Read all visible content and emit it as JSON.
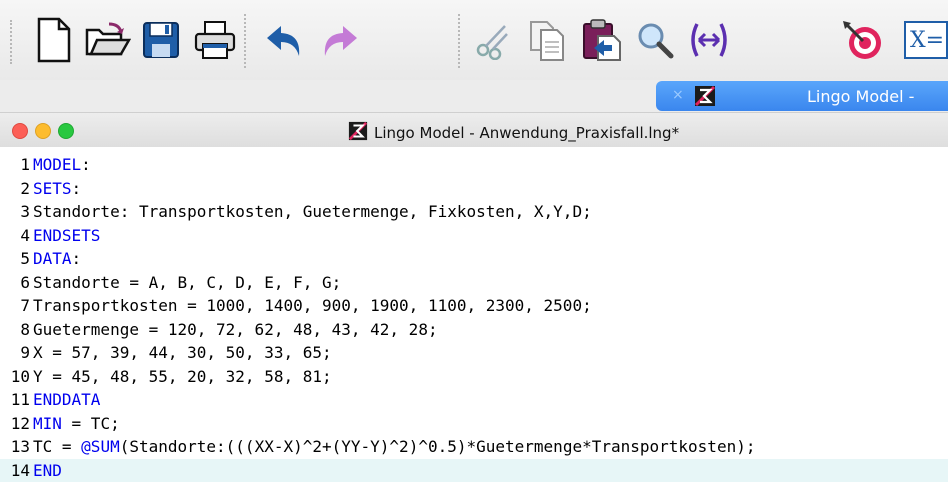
{
  "toolbar": {
    "buttons": [
      {
        "name": "new-file-icon",
        "label": "New"
      },
      {
        "name": "open-folder-icon",
        "label": "Open"
      },
      {
        "name": "save-disk-icon",
        "label": "Save"
      },
      {
        "name": "print-icon",
        "label": "Print"
      },
      {
        "name": "undo-icon",
        "label": "Undo"
      },
      {
        "name": "redo-icon",
        "label": "Redo"
      },
      {
        "name": "cut-scissors-icon",
        "label": "Cut"
      },
      {
        "name": "copy-icon",
        "label": "Copy"
      },
      {
        "name": "paste-icon",
        "label": "Paste"
      },
      {
        "name": "find-magnifier-icon",
        "label": "Find"
      },
      {
        "name": "match-parenthesis-icon",
        "label": "Match Parenthesis"
      },
      {
        "name": "solve-target-icon",
        "label": "Solve"
      },
      {
        "name": "solution-xeq-icon",
        "label": "Solution"
      }
    ],
    "solution_glyph": "X="
  },
  "tab": {
    "close_glyph": "×",
    "title": "Lingo Model -"
  },
  "window": {
    "title": "Lingo Model - Anwendung_Praxisfall.lng*"
  },
  "colors": {
    "keyword": "#0000ee",
    "current_line": "#e7f6f7",
    "tab_active": "#3a86ee",
    "close": "#fc5f57",
    "minimize": "#fdbc2e",
    "zoom": "#28c840"
  },
  "editor": {
    "current_line": 14,
    "lines": [
      {
        "n": "1",
        "kw": "MODEL",
        "rest": ":"
      },
      {
        "n": "2",
        "kw": "SETS",
        "rest": ":"
      },
      {
        "n": "3",
        "kw": "",
        "rest": "Standorte: Transportkosten, Guetermenge, Fixkosten, X,Y,D;"
      },
      {
        "n": "4",
        "kw": "ENDSETS",
        "rest": ""
      },
      {
        "n": "5",
        "kw": "DATA",
        "rest": ":"
      },
      {
        "n": "6",
        "kw": "",
        "rest": "Standorte = A, B, C, D, E, F, G;"
      },
      {
        "n": "7",
        "kw": "",
        "rest": "Transportkosten = 1000, 1400, 900, 1900, 1100, 2300, 2500;"
      },
      {
        "n": "8",
        "kw": "",
        "rest": "Guetermenge = 120, 72, 62, 48, 43, 42, 28;"
      },
      {
        "n": "9",
        "kw": "",
        "rest": "X = 57, 39, 44, 30, 50, 33, 65;"
      },
      {
        "n": "10",
        "kw": "",
        "rest": "Y = 45, 48, 55, 20, 32, 58, 81;"
      },
      {
        "n": "11",
        "kw": "ENDDATA",
        "rest": ""
      },
      {
        "n": "12",
        "kw": "MIN",
        "rest": " = TC;"
      },
      {
        "n": "13",
        "pre": "TC = ",
        "kw": "@SUM",
        "rest": "(Standorte:(((XX-X)^2+(YY-Y)^2)^0.5)*Guetermenge*Transportkosten);"
      },
      {
        "n": "14",
        "kw": "END",
        "rest": ""
      }
    ]
  }
}
